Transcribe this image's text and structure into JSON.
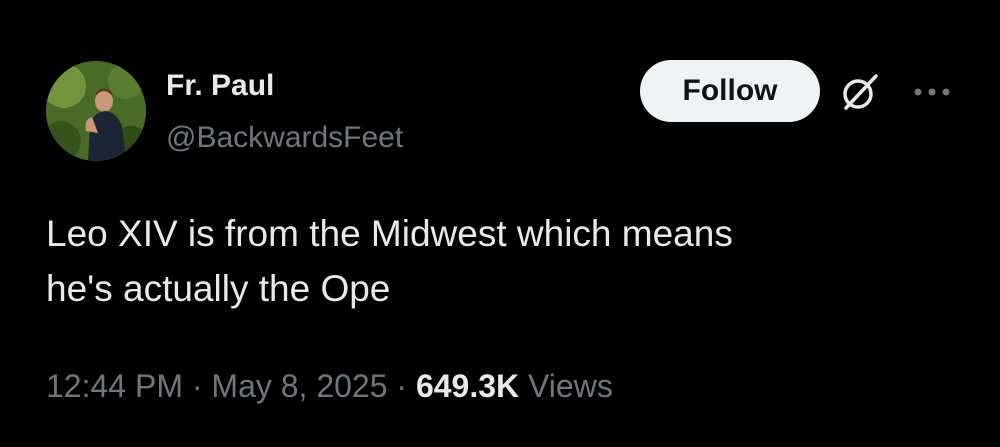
{
  "author": {
    "display_name": "Fr. Paul",
    "handle": "@BackwardsFeet"
  },
  "actions": {
    "follow_label": "Follow",
    "grok_icon": "grok-icon",
    "more_icon": "more-options-icon"
  },
  "tweet": {
    "text_lines": [
      "Leo XIV is from the Midwest which means",
      "he's actually the Ope"
    ]
  },
  "meta": {
    "time": "12:44 PM",
    "separator": " · ",
    "date": "May 8, 2025",
    "views_count": "649.3K",
    "views_label": " Views"
  },
  "colors": {
    "background": "#000000",
    "primary_text": "#e7e9ea",
    "secondary_text": "#71767b",
    "follow_bg": "#eff3f4",
    "follow_text": "#0f1419"
  }
}
